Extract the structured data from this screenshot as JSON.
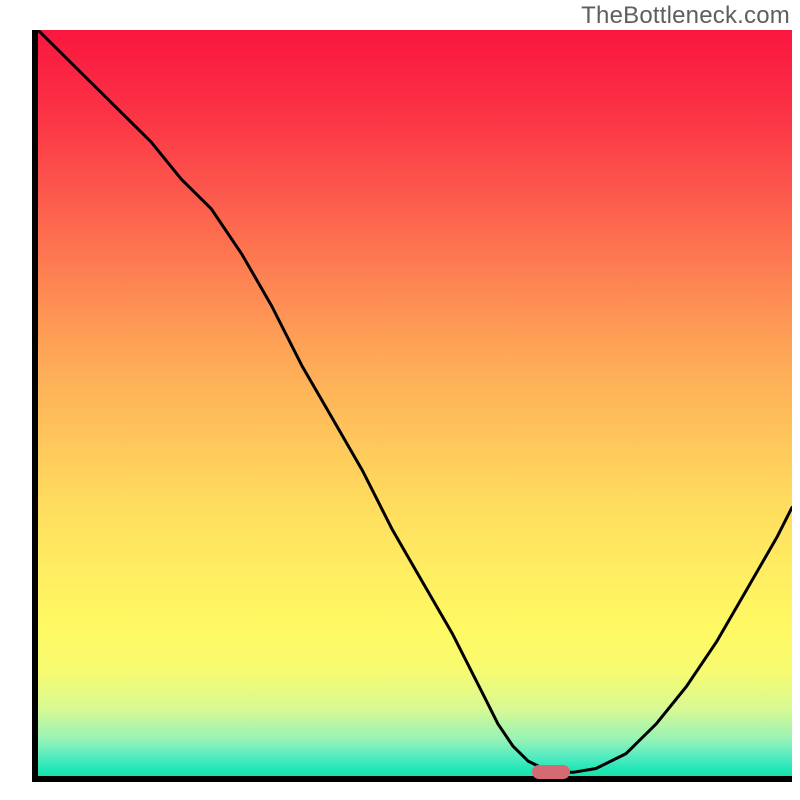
{
  "attribution": "TheBottleneck.com",
  "chart_data": {
    "type": "line",
    "title": "",
    "xlabel": "",
    "ylabel": "",
    "x": [
      0,
      6,
      11,
      15,
      19,
      23,
      27,
      31,
      35,
      39,
      43,
      47,
      51,
      55,
      59,
      61,
      63,
      65,
      67,
      69,
      71,
      74,
      78,
      82,
      86,
      90,
      94,
      98,
      100
    ],
    "values": [
      100,
      94,
      89,
      85,
      80,
      76,
      70,
      63,
      55,
      48,
      41,
      33,
      26,
      19,
      11,
      7,
      4,
      2,
      1,
      0.5,
      0.5,
      1,
      3,
      7,
      12,
      18,
      25,
      32,
      36
    ],
    "xlim": [
      0,
      100
    ],
    "ylim": [
      0,
      100
    ],
    "marker": {
      "x": 68,
      "y": 0.5,
      "color": "#d56a73"
    }
  }
}
